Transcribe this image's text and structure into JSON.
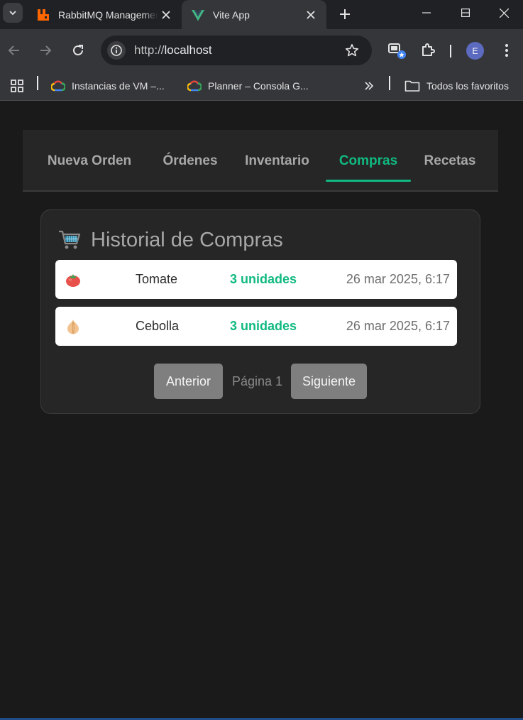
{
  "browser": {
    "tabs": [
      {
        "title": "RabbitMQ Management",
        "active": false
      },
      {
        "title": "Vite App",
        "active": true
      }
    ],
    "url_scheme": "http://",
    "url_host": "localhost",
    "bookmarks": [
      {
        "label": "Instancias de VM –..."
      },
      {
        "label": "Planner – Consola G..."
      }
    ],
    "all_bookmarks_label": "Todos los favoritos",
    "profile_initial": "E"
  },
  "nav": {
    "items": [
      {
        "label": "Nueva Orden"
      },
      {
        "label": "Órdenes"
      },
      {
        "label": "Inventario"
      },
      {
        "label": "Compras"
      },
      {
        "label": "Recetas"
      }
    ],
    "active": "Compras"
  },
  "history": {
    "title": "Historial de Compras",
    "rows": [
      {
        "icon": "tomato-icon",
        "name": "Tomate",
        "quantity": "3 unidades",
        "date": "26 mar 2025, 6:17"
      },
      {
        "icon": "onion-icon",
        "name": "Cebolla",
        "quantity": "3 unidades",
        "date": "26 mar 2025, 6:17"
      }
    ],
    "prev_label": "Anterior",
    "page_label": "Página 1",
    "next_label": "Siguiente"
  },
  "colors": {
    "accent": "#10b981",
    "page_bg": "#1a1a1a",
    "card_bg": "#262626",
    "button_bg": "#7f7f7f"
  }
}
